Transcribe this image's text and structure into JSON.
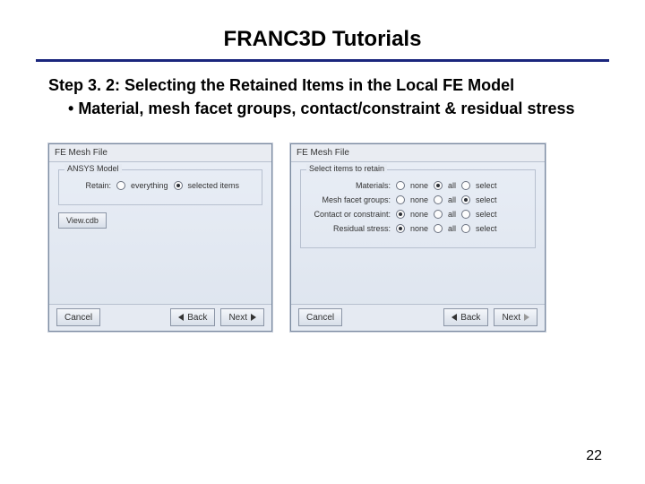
{
  "title": "FRANC3D Tutorials",
  "step": "Step 3. 2: Selecting the Retained Items in the Local FE Model",
  "bullet": "Material, mesh facet groups, contact/constraint & residual stress",
  "page": "22",
  "dialog1": {
    "title": "FE Mesh File",
    "group": "ANSYS Model",
    "retain_label": "Retain:",
    "opt_everything": "everything",
    "opt_selected": "selected items",
    "view_btn": "View.cdb",
    "cancel": "Cancel",
    "back": "Back",
    "next": "Next"
  },
  "dialog2": {
    "title": "FE Mesh File",
    "group": "Select items to retain",
    "row_materials": "Materials:",
    "row_mesh": "Mesh facet groups:",
    "row_contact": "Contact or constraint:",
    "row_residual": "Residual stress:",
    "opt_none": "none",
    "opt_all": "all",
    "opt_select": "select",
    "cancel": "Cancel",
    "back": "Back",
    "next": "Next"
  }
}
